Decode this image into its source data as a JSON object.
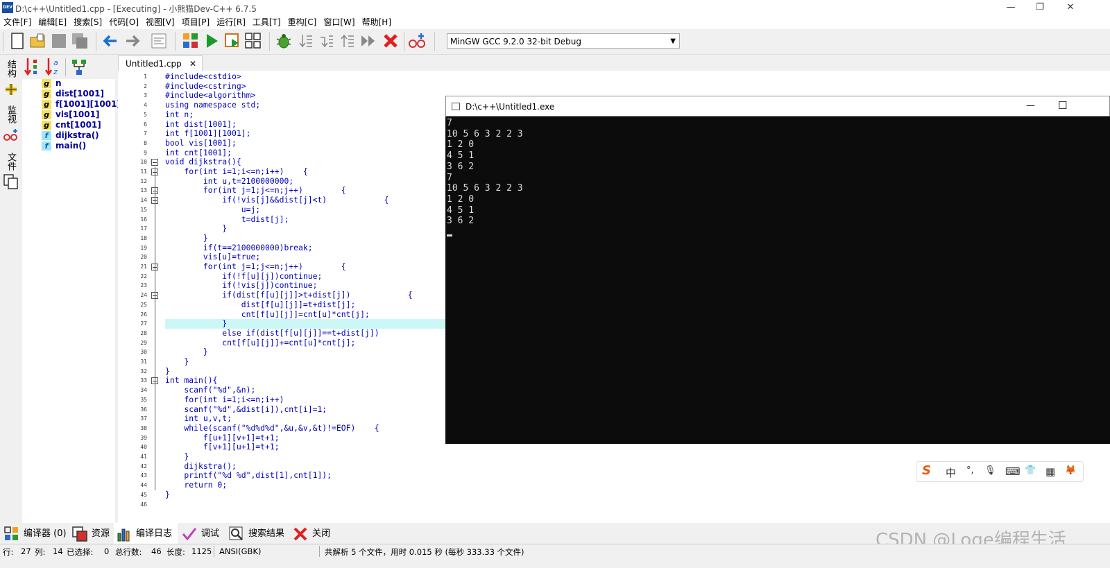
{
  "window": {
    "title": "D:\\c++\\Untitled1.cpp - [Executing] - 小熊猫Dev-C++ 6.7.5",
    "icon_text": "DEV",
    "minimize": "—",
    "restore": "❐",
    "close": "✕"
  },
  "menu": {
    "items": [
      "文件[F]",
      "编辑[E]",
      "搜索[S]",
      "代码[O]",
      "视图[V]",
      "项目[P]",
      "运行[R]",
      "工具[T]",
      "重构[C]",
      "窗口[W]",
      "帮助[H]"
    ]
  },
  "toolbar": {
    "compiler": "MinGW GCC 9.2.0 32-bit Debug"
  },
  "side_tabs": {
    "structure": "结构",
    "watch": "监视",
    "files": "文件"
  },
  "class_browser": {
    "items": [
      {
        "kind": "g",
        "name": "n"
      },
      {
        "kind": "g",
        "name": "dist[1001]"
      },
      {
        "kind": "g",
        "name": "f[1001][1001]"
      },
      {
        "kind": "g",
        "name": "vis[1001]"
      },
      {
        "kind": "g",
        "name": "cnt[1001]"
      },
      {
        "kind": "f",
        "name": "dijkstra()"
      },
      {
        "kind": "f",
        "name": "main()"
      }
    ]
  },
  "editor": {
    "tab_label": "Untitled1.cpp",
    "tab_close": "✕",
    "lines": [
      "#include<cstdio>",
      "#include<cstring>",
      "#include<algorithm>",
      "using namespace std;",
      "int n;",
      "int dist[1001];",
      "int f[1001][1001];",
      "bool vis[1001];",
      "int cnt[1001];",
      "void dijkstra(){",
      "    for(int i=1;i<=n;i++)    {",
      "        int u,t=2100000000;",
      "        for(int j=1;j<=n;j++)        {",
      "            if(!vis[j]&&dist[j]<t)            {",
      "                u=j;",
      "                t=dist[j];",
      "            }",
      "        }",
      "        if(t==2100000000)break;",
      "        vis[u]=true;",
      "        for(int j=1;j<=n;j++)        {",
      "            if(!f[u][j])continue;",
      "            if(!vis[j])continue;",
      "            if(dist[f[u][j]]>t+dist[j])            {",
      "                dist[f[u][j]]=t+dist[j];",
      "                cnt[f[u][j]]=cnt[u]*cnt[j];",
      "            }",
      "            else if(dist[f[u][j]]==t+dist[j])",
      "            cnt[f[u][j]]+=cnt[u]*cnt[j];",
      "        }",
      "    }",
      "}",
      "int main(){",
      "    scanf(\"%d\",&n);",
      "    for(int i=1;i<=n;i++)",
      "    scanf(\"%d\",&dist[i]),cnt[i]=1;",
      "    int u,v,t;",
      "    while(scanf(\"%d%d%d\",&u,&v,&t)!=EOF)    {",
      "        f[u+1][v+1]=t+1;",
      "        f[v+1][u+1]=t+1;",
      "    }",
      "    dijkstra();",
      "    printf(\"%d %d\",dist[1],cnt[1]);",
      "    return 0;",
      "}",
      ""
    ],
    "current_line": 27,
    "fold_lines": [
      10,
      11,
      13,
      14,
      21,
      24,
      33
    ]
  },
  "console": {
    "title": "D:\\c++\\Untitled1.exe",
    "minimize": "—",
    "maximize": "☐",
    "lines": [
      "7",
      "10 5 6 3 2 2 3",
      "1 2 0",
      "4 5 1",
      "3 6 2",
      "7",
      "10 5 6 3 2 2 3",
      "1 2 0",
      "4 5 1",
      "3 6 2"
    ]
  },
  "ime": {
    "logo": "S",
    "lang": "中",
    "punct": "°,",
    "mic": "🎙",
    "keyboard": "⌨",
    "skin": "👕",
    "grid": "▦",
    "more": "🦊"
  },
  "bottom_tabs": [
    {
      "label": "编译器 (0)"
    },
    {
      "label": "资源"
    },
    {
      "label": "编译日志"
    },
    {
      "label": "调试"
    },
    {
      "label": "搜索结果"
    },
    {
      "label": "关闭"
    }
  ],
  "status": {
    "row_label": "行:",
    "row": "27",
    "col_label": "列:",
    "col": "14",
    "sel_label": "已选择:",
    "sel": "0",
    "total_label": "总行数:",
    "total": "46",
    "len_label": "长度:",
    "len": "1125",
    "encoding": "ANSI(GBK)",
    "message": "共解析 5 个文件，用时 0.015 秒 (每秒 333.33 个文件)"
  },
  "watermark": "CSDN @Loge编程生活"
}
